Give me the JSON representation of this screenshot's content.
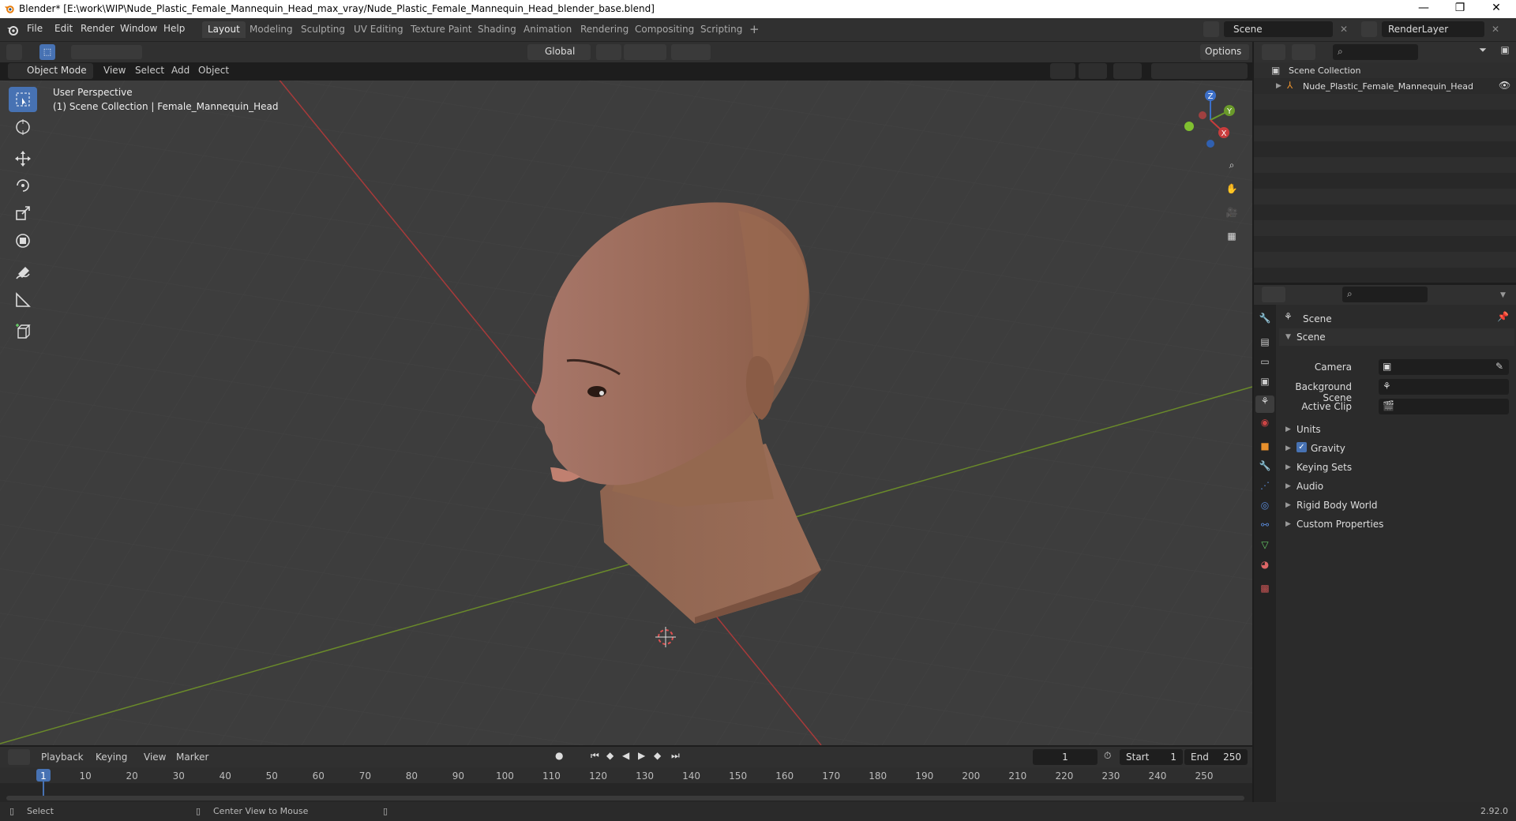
{
  "titlebar": {
    "title": "Blender* [E:\\work\\WIP\\Nude_Plastic_Female_Mannequin_Head_max_vray/Nude_Plastic_Female_Mannequin_Head_blender_base.blend]",
    "minimize": "—",
    "maximize": "❐",
    "close": "✕"
  },
  "menus": [
    "File",
    "Edit",
    "Render",
    "Window",
    "Help"
  ],
  "workspaces": [
    "Layout",
    "Modeling",
    "Sculpting",
    "UV Editing",
    "Texture Paint",
    "Shading",
    "Animation",
    "Rendering",
    "Compositing",
    "Scripting"
  ],
  "add_workspace": "+",
  "scene_selector": {
    "value": "Scene"
  },
  "renderlayer_selector": {
    "value": "RenderLayer"
  },
  "viewport_header": {
    "mode": "Object Mode",
    "menus": [
      "View",
      "Select",
      "Add",
      "Object"
    ],
    "orientation": "Global",
    "options": "Options"
  },
  "viewport_overlay": {
    "perspective": "User Perspective",
    "collection_info": "(1) Scene Collection | Female_Mannequin_Head"
  },
  "gizmo": {
    "x": "X",
    "y": "Y",
    "z": "Z"
  },
  "outliner": {
    "root": "Scene Collection",
    "items": [
      {
        "label": "Nude_Plastic_Female_Mannequin_Head"
      }
    ]
  },
  "properties": {
    "context": "Scene",
    "panel_title": "Scene",
    "fields": [
      {
        "label": "Camera"
      },
      {
        "label": "Background Scene"
      },
      {
        "label": "Active Clip"
      }
    ],
    "sections": [
      "Units",
      "Gravity",
      "Keying Sets",
      "Audio",
      "Rigid Body World",
      "Custom Properties"
    ]
  },
  "timeline": {
    "menus": [
      "Playback",
      "Keying",
      "View",
      "Marker"
    ],
    "current_frame": "1",
    "start_label": "Start",
    "start": "1",
    "end_label": "End",
    "end": "250",
    "ticks": [
      "1",
      "10",
      "20",
      "30",
      "40",
      "50",
      "60",
      "70",
      "80",
      "90",
      "100",
      "110",
      "120",
      "130",
      "140",
      "150",
      "160",
      "170",
      "180",
      "190",
      "200",
      "210",
      "220",
      "230",
      "240",
      "250"
    ]
  },
  "statusbar": {
    "select": "Select",
    "center_view": "Center View to Mouse",
    "version": "2.92.0"
  },
  "colors": {
    "accent": "#4772b3",
    "x_axis": "#c83c3c",
    "y_axis": "#6a9a2a",
    "skin": "#a0705a"
  }
}
